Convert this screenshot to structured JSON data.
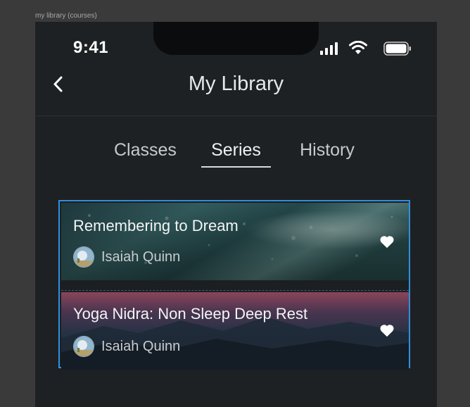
{
  "frame_label": "my library (courses)",
  "status_bar": {
    "time": "9:41",
    "icons": [
      "signal-icon",
      "wifi-icon",
      "battery-icon"
    ]
  },
  "header": {
    "back_icon": "chevron-left-icon",
    "title": "My Library"
  },
  "tabs": [
    {
      "label": "Classes",
      "active": false
    },
    {
      "label": "Series",
      "active": true
    },
    {
      "label": "History",
      "active": false
    }
  ],
  "series": [
    {
      "title": "Remembering to Dream",
      "author": "Isaiah Quinn",
      "favorite_icon": "heart-icon",
      "theme": "teal-rain"
    },
    {
      "title": "Yoga Nidra: Non Sleep Deep Rest",
      "author": "Isaiah Quinn",
      "favorite_icon": "heart-icon",
      "theme": "dusk-mountains"
    }
  ],
  "colors": {
    "selection_border": "#2f8fe0",
    "background": "#1e2123"
  }
}
